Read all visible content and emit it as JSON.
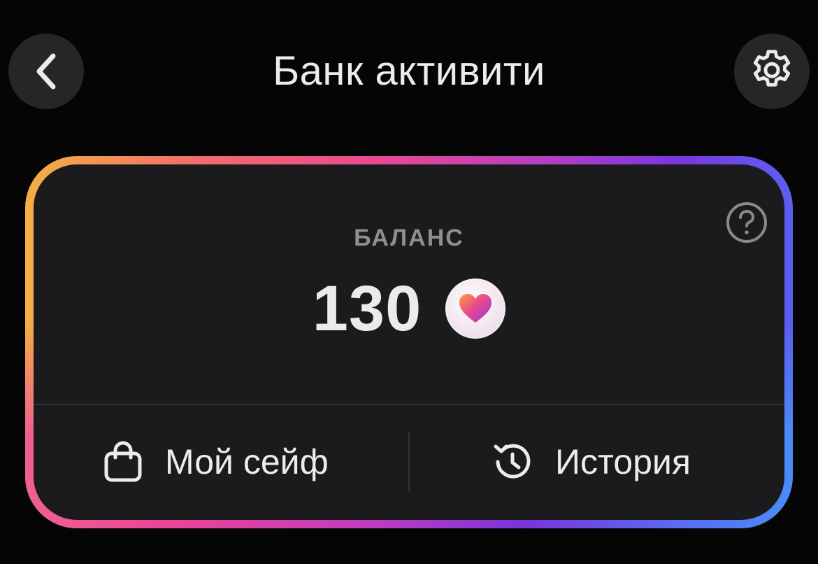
{
  "header": {
    "title": "Банк активити",
    "back_icon": "chevron-left-icon",
    "settings_icon": "gear-icon"
  },
  "balance_card": {
    "label": "БАЛАНС",
    "value": "130",
    "currency_icon": "heart-coin-icon",
    "help_icon": "question-circle-icon",
    "border_gradient": [
      "#f4b044",
      "#ea4a90",
      "#7a36e0",
      "#4a8cf6"
    ]
  },
  "actions": [
    {
      "label": "Мой сейф",
      "icon": "shopping-bag-icon"
    },
    {
      "label": "История",
      "icon": "history-icon"
    }
  ],
  "colors": {
    "background": "#050505",
    "card": "#1b1b1d",
    "button_bg": "#262626",
    "text_primary": "#ececec",
    "text_secondary": "#8e8e90"
  }
}
